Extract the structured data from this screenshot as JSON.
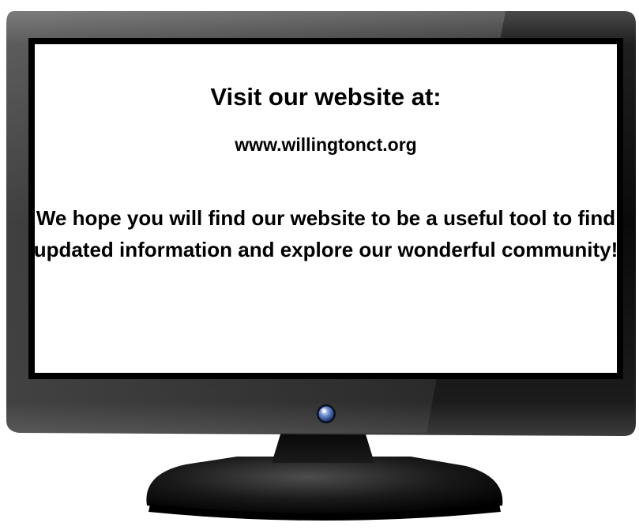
{
  "screen": {
    "heading": "Visit our website at:",
    "url": "www.willingtonct.org",
    "message": "We hope you will find our website to be a useful tool to find updated information and explore our wonderful community!"
  },
  "colors": {
    "bezel": "#0d0d0d",
    "screen_background": "#ffffff",
    "text": "#000000",
    "power_button": "#3a5fa8"
  },
  "icons": {
    "power_button": "power-button-icon"
  }
}
